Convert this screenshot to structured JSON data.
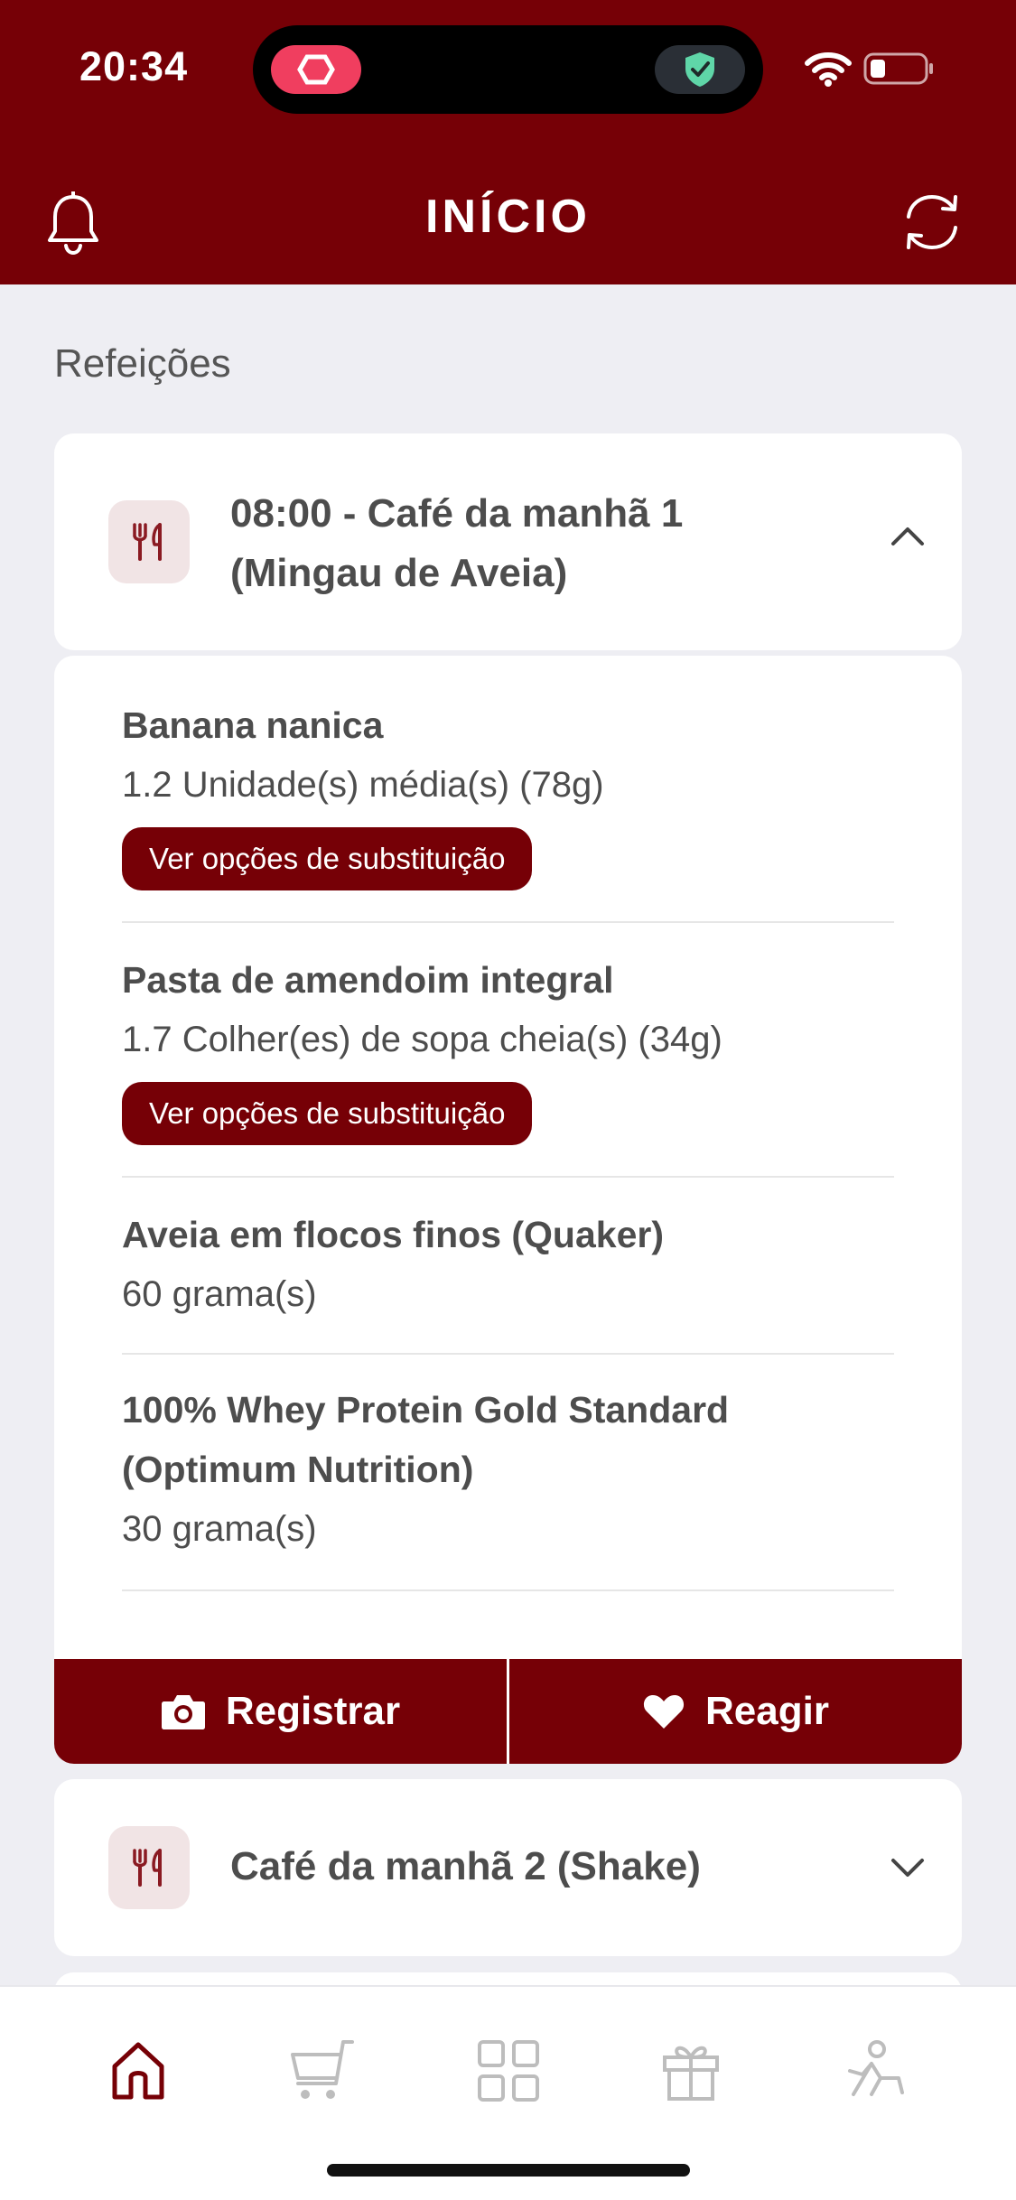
{
  "status_bar": {
    "time": "20:34"
  },
  "header": {
    "title": "INÍCIO"
  },
  "section_title": "Refeições",
  "meals": [
    {
      "title_line1": "08:00 - Café da manhã 1",
      "title_line2": "(Mingau de Aveia)",
      "expanded": true,
      "foods": [
        {
          "name": "Banana nanica",
          "qty": "1.2 Unidade(s) média(s) (78g)",
          "button": "Ver opções de substituição"
        },
        {
          "name": "Pasta de amendoim integral",
          "qty": "1.7 Colher(es) de sopa cheia(s) (34g)",
          "button": "Ver opções de substituição"
        },
        {
          "name": "Aveia em flocos finos (Quaker)",
          "qty": "60 grama(s)"
        },
        {
          "name_line1": "100% Whey Protein Gold Standard",
          "name_line2": "(Optimum Nutrition)",
          "qty": "30 grama(s)"
        }
      ],
      "actions": {
        "register": "Registrar",
        "react": "Reagir"
      }
    },
    {
      "title": "Café da manhã 2 (Shake)",
      "expanded": false
    }
  ],
  "icons": {
    "bell": "bell-icon",
    "refresh": "refresh-icon",
    "meal": "cutlery-icon",
    "chevron_up": "chevron-up-icon",
    "chevron_down": "chevron-down-icon",
    "camera": "camera-icon",
    "heart": "heart-icon",
    "nav": [
      "home-icon",
      "cart-icon",
      "grid-icon",
      "gift-icon",
      "exercise-icon"
    ]
  },
  "colors": {
    "brand": "#760006",
    "background": "#eeeef3",
    "icon_tile": "#f1e4e5"
  }
}
